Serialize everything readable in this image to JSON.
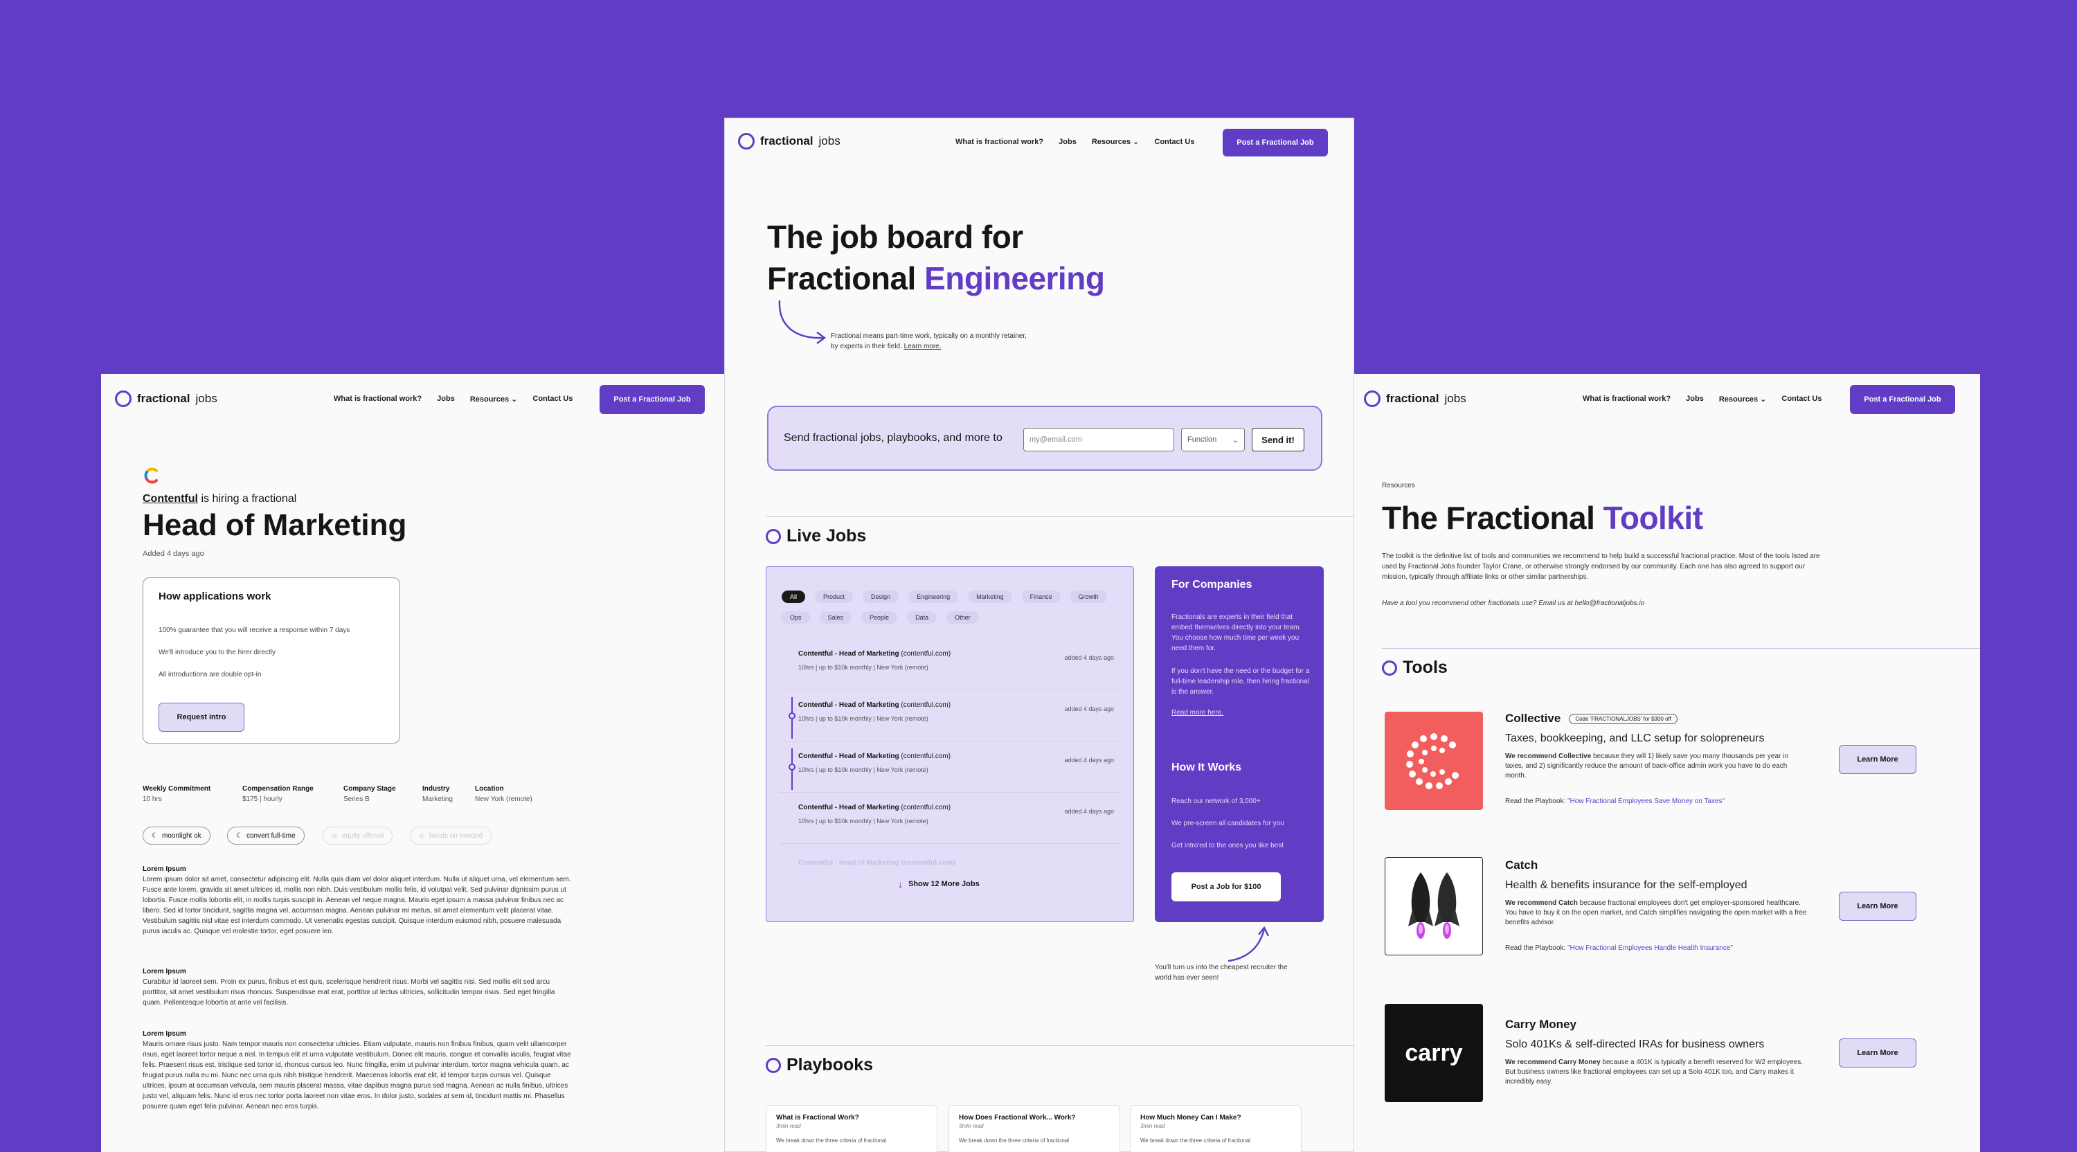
{
  "nav": {
    "logo_bold": "fractional",
    "logo_light": "jobs",
    "links": [
      "What is fractional work?",
      "Jobs",
      "Resources",
      "Contact Us"
    ],
    "cta": "Post a Fractional Job"
  },
  "home": {
    "hero_line1": "The job board for",
    "hero_line2_plain": "Fractional",
    "hero_line2_accent": "Engineering",
    "note": "Fractional means part-time work, typically on a monthly retainer, by experts in their field.",
    "note_link": "Learn more.",
    "signup_text": "Send fractional jobs, playbooks, and more to",
    "email_placeholder": "my@email.com",
    "function_label": "Function",
    "send_label": "Send it!",
    "live_jobs_heading": "Live Jobs",
    "filters": [
      "All",
      "Product",
      "Design",
      "Engineering",
      "Marketing",
      "Finance",
      "Growth",
      "Ops",
      "Sales",
      "People",
      "Data",
      "Other"
    ],
    "jobs": [
      {
        "company": "Contentful",
        "role": "Head of Marketing",
        "domain": "(contentful.com)",
        "sub": "10hrs | up to $10k monthly | New York (remote)",
        "age": "added 4 days ago"
      },
      {
        "company": "Contentful",
        "role": "Head of Marketing",
        "domain": "(contentful.com)",
        "sub": "10hrs | up to $10k monthly | New York (remote)",
        "age": "added 4 days ago"
      },
      {
        "company": "Contentful",
        "role": "Head of Marketing",
        "domain": "(contentful.com)",
        "sub": "10hrs | up to $10k monthly | New York (remote)",
        "age": "added 4 days ago"
      },
      {
        "company": "Contentful",
        "role": "Head of Marketing",
        "domain": "(contentful.com)",
        "sub": "10hrs | up to $10k monthly | New York (remote)",
        "age": "added 4 days ago"
      }
    ],
    "faded_job": "Contentful - Head of Marketing (contentful.com)",
    "show_more": "Show 12 More Jobs",
    "companies_title": "For Companies",
    "companies_p1": "Fractionals are experts in their field that embed themselves directly into your team. You choose how much time per week you need them for.",
    "companies_p2": "If you don't have the need or the budget for a full-time leadership role, then hiring fractional is the answer.",
    "read_more": "Read more here.",
    "how_title": "How It Works",
    "how_items": [
      "Reach our network of 3,000+",
      "We pre-screen all candidates for you",
      "Get intro'ed to the ones you like best"
    ],
    "post_job_btn": "Post a Job for $100",
    "recruiter_note": "You'll turn us into the cheapest recruiter the world has ever seen!",
    "playbooks_heading": "Playbooks",
    "playbooks": [
      {
        "title": "What is Fractional Work?",
        "read": "3min read",
        "desc": "We break down the three criteria of fractional"
      },
      {
        "title": "How Does Fractional Work... Work?",
        "read": "3min read",
        "desc": "We break down the three criteria of fractional"
      },
      {
        "title": "How Much Money Can I Make?",
        "read": "3min read",
        "desc": "We break down the three criteria of fractional"
      }
    ]
  },
  "job_page": {
    "company": "Contentful",
    "hiring": "is hiring a fractional",
    "title": "Head of Marketing",
    "added": "Added 4 days ago",
    "how_title": "How applications work",
    "how_items": [
      "100% guarantee that you will receive a response within 7 days",
      "We'll introduce you to the hirer directly",
      "All introductions are double opt-in"
    ],
    "request_btn": "Request intro",
    "meta": [
      {
        "label": "Weekly Commitment",
        "value": "10 hrs"
      },
      {
        "label": "Compensation Range",
        "value": "$175 | hourly"
      },
      {
        "label": "Company Stage",
        "value": "Series B"
      },
      {
        "label": "Industry",
        "value": "Marketing"
      },
      {
        "label": "Location",
        "value": "New York (remote)"
      }
    ],
    "tags": [
      "moonlight ok",
      "convert full-time",
      "equity offered",
      "hands on needed"
    ],
    "sections": [
      {
        "h": "Lorem Ipsum",
        "p": "Lorem ipsum dolor sit amet, consectetur adipiscing elit. Nulla quis diam vel dolor aliquet interdum. Nulla ut aliquet urna, vel elementum sem. Fusce ante lorem, gravida sit amet ultrices id, mollis non nibh. Duis vestibulum mollis felis, id volutpat velit. Sed pulvinar dignissim purus ut lobortis. Fusce mollis lobortis elit, in mollis turpis suscipit in. Aenean vel neque magna. Mauris eget ipsum a massa pulvinar finibus nec ac libero. Sed id tortor tincidunt, sagittis magna vel, accumsan magna. Aenean pulvinar mi metus, sit amet elementum velit placerat vitae. Vestibulum sagittis nisl vitae est interdum commodo. Ut venenatis egestas suscipit. Quisque interdum euismod nibh, posuere malesuada purus iaculis ac. Quisque vel molestie tortor, eget posuere leo."
      },
      {
        "h": "Lorem Ipsum",
        "p": "Curabitur id laoreet sem. Proin ex purus, finibus et est quis, scelerisque hendrerit risus. Morbi vel sagittis nisi. Sed mollis elit sed arcu porttitor, sit amet vestibulum risus rhoncus. Suspendisse erat erat, porttitor ut lectus ultricies, sollicitudin tempor risus. Sed eget fringilla quam. Pellentesque lobortis at ante vel facilisis."
      },
      {
        "h": "Lorem Ipsum",
        "p": "Mauris ornare risus justo. Nam tempor mauris non consectetur ultricies. Etiam vulputate, mauris non finibus finibus, quam velit ullamcorper risus, eget laoreet tortor neque a nisl. In tempus elit et urna vulputate vestibulum. Donec elit mauris, congue et convallis iaculis, feugiat vitae felis. Praesent risus est, tristique sed tortor id, rhoncus cursus leo. Nunc fringilla, enim ut pulvinar interdum, tortor magna vehicula quam, ac feugiat purus nulla eu mi. Nunc nec urna quis nibh tristique hendrerit. Maecenas lobortis erat elit, id tempor turpis cursus vel. Quisque ultrices, ipsum at accumsan vehicula, sem mauris placerat massa, vitae dapibus magna purus sed magna. Aenean ac nulla finibus, ultrices justo vel, aliquam felis. Nunc id eros nec tortor porta laoreet non vitae eros. In dolor justo, sodales at sem id, tincidunt mattis mi. Phasellus posuere quam eget felis pulvinar. Aenean nec eros turpis."
      }
    ]
  },
  "toolkit": {
    "breadcrumb": "Resources",
    "title_plain": "The Fractional",
    "title_accent": "Toolkit",
    "intro": "The toolkit is the definitive list of tools and communities we recommend to help build a successful fractional practice. Most of the tools listed are used by Fractional Jobs founder Taylor Crane, or otherwise strongly endorsed by our community. Each one has also agreed to support our mission, typically through affiliate links or other similar partnerships.",
    "ask": "Have a tool you recommend other fractionals use? Email us at hello@fractionaljobs.io",
    "tools_heading": "Tools",
    "tools": [
      {
        "name": "Collective",
        "code": "Code 'FRACTIONALJOBS' for $300 off",
        "sub": "Taxes, bookkeeping, and LLC setup for solopreneurs",
        "rec_bold": "We recommend Collective",
        "rec": "because they will 1) likely save you many thousands per year in taxes, and 2) significantly reduce the amount of back-office admin work you have to do each month.",
        "read_prefix": "Read the Playbook:",
        "read_link": "\"How Fractional Employees Save Money on Taxes\"",
        "btn": "Learn More",
        "logo_bg": "#F25E5E"
      },
      {
        "name": "Catch",
        "code": "",
        "sub": "Health & benefits insurance for the self-employed",
        "rec_bold": "We recommend Catch",
        "rec": "because fractional employees don't get employer-sponsored healthcare. You have to buy it on the open market, and Catch simplifies navigating the open market with a free benefits advisor.",
        "read_prefix": "Read the Playbook:",
        "read_link": "\"How Fractional Employees Handle Health Insurance\"",
        "btn": "Learn More",
        "logo_bg": "#FFFFFF"
      },
      {
        "name": "Carry Money",
        "code": "",
        "sub": "Solo 401Ks & self-directed IRAs for business owners",
        "rec_bold": "We recommend Carry Money",
        "rec": "because a 401K is typically a benefit reserved for W2 employees. But business owners like fractional employees can set up a Solo 401K too, and Carry makes it incredibly easy.",
        "read_prefix": "",
        "read_link": "",
        "btn": "Learn More",
        "logo_bg": "#111111",
        "logo_text": "carry"
      }
    ]
  },
  "colors": {
    "background": "#613DC5",
    "accent": "#613DC5",
    "page": "#FAFAFA"
  }
}
